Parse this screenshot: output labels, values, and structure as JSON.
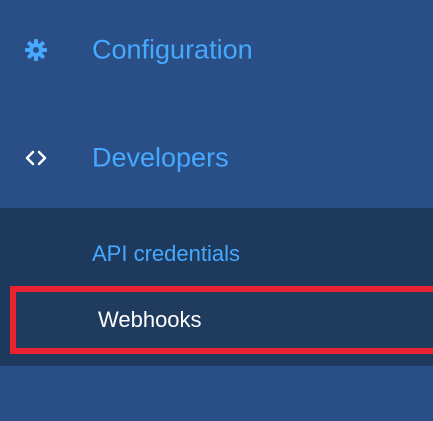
{
  "sidebar": {
    "accent_color": "#46a8ff",
    "highlight_color": "#e8232f",
    "items": [
      {
        "label": "Configuration",
        "icon": "gear-icon"
      },
      {
        "label": "Developers",
        "icon": "code-icon",
        "expanded": true
      }
    ],
    "submenu": [
      {
        "label": "API credentials"
      },
      {
        "label": "Webhooks",
        "highlighted": true
      }
    ]
  }
}
